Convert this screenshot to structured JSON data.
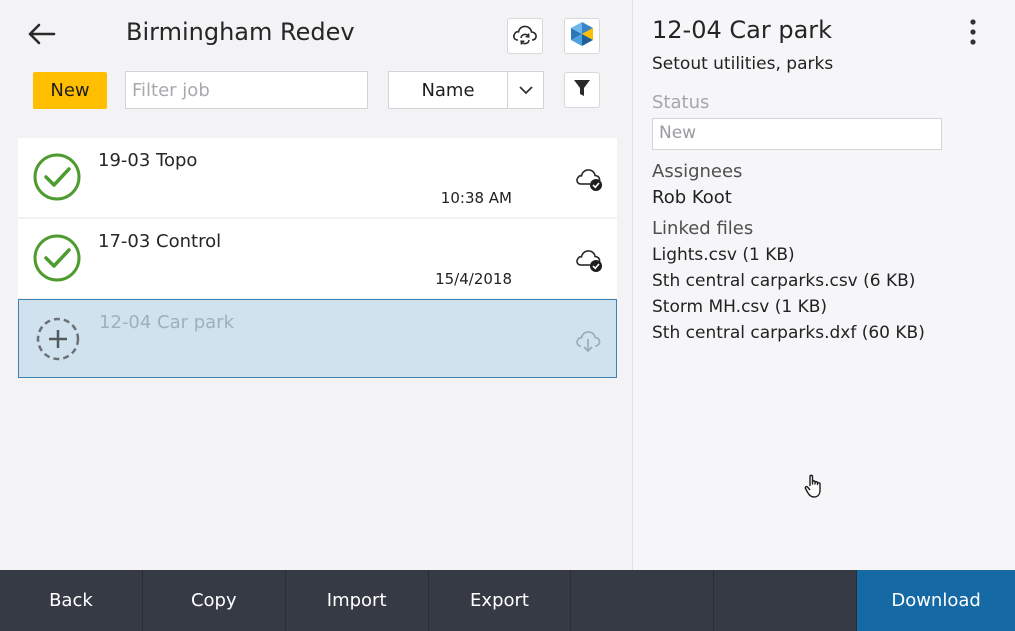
{
  "header": {
    "title": "Birmingham Redev",
    "new_label": "New",
    "filter_placeholder": "Filter job",
    "sort_label": "Name"
  },
  "jobs": [
    {
      "name": "19-03 Topo",
      "date": "10:38 AM",
      "status": "complete",
      "cloud": "synced"
    },
    {
      "name": "17-03 Control",
      "date": "15/4/2018",
      "status": "complete",
      "cloud": "synced"
    },
    {
      "name": "12-04 Car park",
      "date": "",
      "status": "new",
      "cloud": "download",
      "selected": true
    }
  ],
  "detail": {
    "title": "12-04 Car park",
    "subtitle": "Setout utilities, parks",
    "status_label": "Status",
    "status_value": "New",
    "assignees_label": "Assignees",
    "assignee": "Rob Koot",
    "linked_files_label": "Linked files",
    "files": [
      "Lights.csv (1 KB)",
      "Sth central carparks.csv (6 KB)",
      "Storm MH.csv (1 KB)",
      "Sth central carparks.dxf (60 KB)"
    ]
  },
  "bottom_bar": {
    "back": "Back",
    "copy": "Copy",
    "import": "Import",
    "export": "Export",
    "download": "Download"
  },
  "colors": {
    "accent_yellow": "#ffbe00",
    "primary_blue": "#1569a4",
    "check_green": "#4e9b2f",
    "selected_row": "#cfe2ee",
    "bottom_bar": "#363a45"
  }
}
